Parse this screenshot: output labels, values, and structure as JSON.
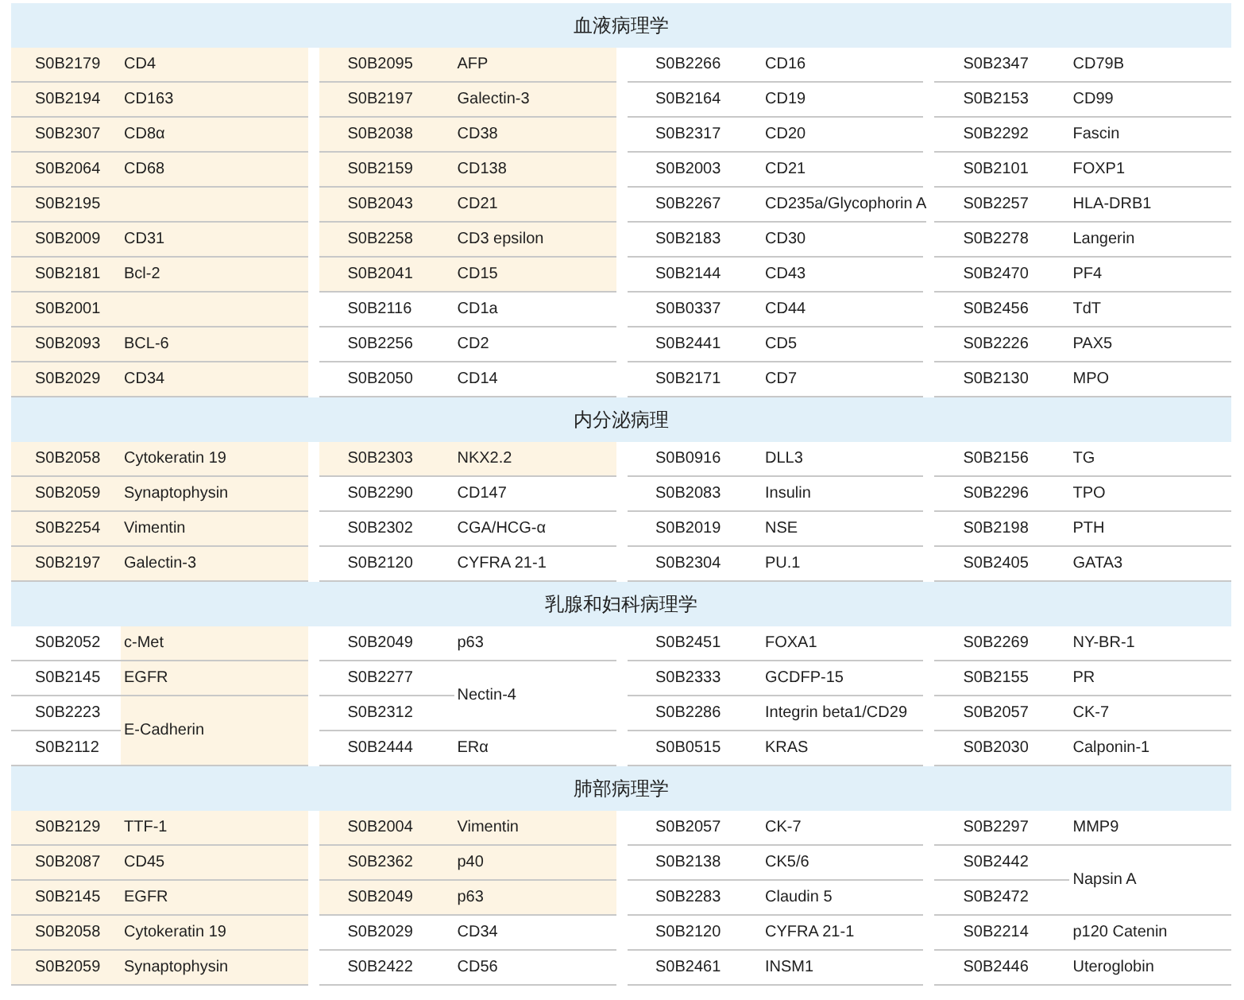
{
  "sections": [
    {
      "title": "血液病理学",
      "columns": [
        [
          {
            "codes": [
              "S0B2179"
            ],
            "name": "CD4",
            "code_shaded": true,
            "name_shaded": true
          },
          {
            "codes": [
              "S0B2194"
            ],
            "name": "CD163",
            "code_shaded": true,
            "name_shaded": true
          },
          {
            "codes": [
              "S0B2307"
            ],
            "name": "CD8α",
            "code_shaded": true,
            "name_shaded": true
          },
          {
            "codes": [
              "S0B2064"
            ],
            "name": "CD68",
            "code_shaded": true,
            "name_shaded": true
          },
          {
            "codes": [
              "S0B2195"
            ],
            "code_shaded": true,
            "name_shaded": true
          },
          {
            "codes": [
              "S0B2009"
            ],
            "name": "CD31",
            "code_shaded": true,
            "name_shaded": true
          },
          {
            "codes": [
              "S0B2181"
            ],
            "name": "Bcl-2",
            "code_shaded": true,
            "name_shaded": true
          },
          {
            "codes": [
              "S0B2001"
            ],
            "code_shaded": true,
            "name_shaded": true
          },
          {
            "codes": [
              "S0B2093"
            ],
            "name": "BCL-6",
            "code_shaded": true,
            "name_shaded": true
          },
          {
            "codes": [
              "S0B2029"
            ],
            "name": "CD34",
            "code_shaded": true,
            "name_shaded": true
          }
        ],
        [
          {
            "codes": [
              "S0B2095"
            ],
            "name": "AFP",
            "code_shaded": true,
            "name_shaded": true
          },
          {
            "codes": [
              "S0B2197"
            ],
            "name": "Galectin-3",
            "code_shaded": true,
            "name_shaded": true
          },
          {
            "codes": [
              "S0B2038"
            ],
            "name": "CD38",
            "code_shaded": true,
            "name_shaded": true
          },
          {
            "codes": [
              "S0B2159"
            ],
            "name": "CD138",
            "code_shaded": true,
            "name_shaded": true
          },
          {
            "codes": [
              "S0B2043"
            ],
            "name": "CD21",
            "code_shaded": true,
            "name_shaded": true
          },
          {
            "codes": [
              "S0B2258"
            ],
            "name": "CD3 epsilon",
            "code_shaded": true,
            "name_shaded": true
          },
          {
            "codes": [
              "S0B2041"
            ],
            "name": "CD15",
            "code_shaded": true,
            "name_shaded": true
          },
          {
            "codes": [
              "S0B2116"
            ],
            "name": "CD1a",
            "code_shaded": false,
            "name_shaded": false
          },
          {
            "codes": [
              "S0B2256"
            ],
            "name": "CD2",
            "code_shaded": false,
            "name_shaded": false
          },
          {
            "codes": [
              "S0B2050"
            ],
            "name": "CD14",
            "code_shaded": false,
            "name_shaded": false
          }
        ],
        [
          {
            "codes": [
              "S0B2266"
            ],
            "name": "CD16",
            "code_shaded": false,
            "name_shaded": false
          },
          {
            "codes": [
              "S0B2164"
            ],
            "name": "CD19",
            "code_shaded": false,
            "name_shaded": false
          },
          {
            "codes": [
              "S0B2317"
            ],
            "name": "CD20",
            "code_shaded": false,
            "name_shaded": false
          },
          {
            "codes": [
              "S0B2003"
            ],
            "name": "CD21",
            "code_shaded": false,
            "name_shaded": false
          },
          {
            "codes": [
              "S0B2267"
            ],
            "name": "CD235a/Glycophorin A",
            "code_shaded": false,
            "name_shaded": false
          },
          {
            "codes": [
              "S0B2183"
            ],
            "name": "CD30",
            "code_shaded": false,
            "name_shaded": false
          },
          {
            "codes": [
              "S0B2144"
            ],
            "name": "CD43",
            "code_shaded": false,
            "name_shaded": false
          },
          {
            "codes": [
              "S0B0337"
            ],
            "name": "CD44",
            "code_shaded": false,
            "name_shaded": false
          },
          {
            "codes": [
              "S0B2441"
            ],
            "name": "CD5",
            "code_shaded": false,
            "name_shaded": false
          },
          {
            "codes": [
              "S0B2171"
            ],
            "name": "CD7",
            "code_shaded": false,
            "name_shaded": false
          }
        ],
        [
          {
            "codes": [
              "S0B2347"
            ],
            "name": "CD79B",
            "code_shaded": false,
            "name_shaded": false
          },
          {
            "codes": [
              "S0B2153"
            ],
            "name": "CD99",
            "code_shaded": false,
            "name_shaded": false
          },
          {
            "codes": [
              "S0B2292"
            ],
            "name": "Fascin",
            "code_shaded": false,
            "name_shaded": false
          },
          {
            "codes": [
              "S0B2101"
            ],
            "name": "FOXP1",
            "code_shaded": false,
            "name_shaded": false
          },
          {
            "codes": [
              "S0B2257"
            ],
            "name": "HLA-DRB1",
            "code_shaded": false,
            "name_shaded": false
          },
          {
            "codes": [
              "S0B2278"
            ],
            "name": "Langerin",
            "code_shaded": false,
            "name_shaded": false
          },
          {
            "codes": [
              "S0B2470"
            ],
            "name": "PF4",
            "code_shaded": false,
            "name_shaded": false
          },
          {
            "codes": [
              "S0B2456"
            ],
            "name": "TdT",
            "code_shaded": false,
            "name_shaded": false
          },
          {
            "codes": [
              "S0B2226"
            ],
            "name": "PAX5",
            "code_shaded": false,
            "name_shaded": false
          },
          {
            "codes": [
              "S0B2130"
            ],
            "name": "MPO",
            "code_shaded": false,
            "name_shaded": false
          }
        ]
      ]
    },
    {
      "title": "内分泌病理",
      "columns": [
        [
          {
            "codes": [
              "S0B2058"
            ],
            "name": "Cytokeratin 19",
            "code_shaded": true,
            "name_shaded": true
          },
          {
            "codes": [
              "S0B2059"
            ],
            "name": "Synaptophysin",
            "code_shaded": true,
            "name_shaded": true
          },
          {
            "codes": [
              "S0B2254"
            ],
            "name": "Vimentin",
            "code_shaded": true,
            "name_shaded": true
          },
          {
            "codes": [
              "S0B2197"
            ],
            "name": "Galectin-3",
            "code_shaded": true,
            "name_shaded": true
          }
        ],
        [
          {
            "codes": [
              "S0B2303"
            ],
            "name": "NKX2.2",
            "code_shaded": true,
            "name_shaded": true
          },
          {
            "codes": [
              "S0B2290"
            ],
            "name": "CD147",
            "code_shaded": false,
            "name_shaded": false
          },
          {
            "codes": [
              "S0B2302"
            ],
            "name": "CGA/HCG-α",
            "code_shaded": false,
            "name_shaded": false
          },
          {
            "codes": [
              "S0B2120"
            ],
            "name": "CYFRA 21-1",
            "code_shaded": false,
            "name_shaded": false
          }
        ],
        [
          {
            "codes": [
              "S0B0916"
            ],
            "name": "DLL3",
            "code_shaded": false,
            "name_shaded": false
          },
          {
            "codes": [
              "S0B2083"
            ],
            "name": "Insulin",
            "code_shaded": false,
            "name_shaded": false
          },
          {
            "codes": [
              "S0B2019"
            ],
            "name": "NSE",
            "code_shaded": false,
            "name_shaded": false
          },
          {
            "codes": [
              "S0B2304"
            ],
            "name": "PU.1",
            "code_shaded": false,
            "name_shaded": false
          }
        ],
        [
          {
            "codes": [
              "S0B2156"
            ],
            "name": "TG",
            "code_shaded": false,
            "name_shaded": false
          },
          {
            "codes": [
              "S0B2296"
            ],
            "name": "TPO",
            "code_shaded": false,
            "name_shaded": false
          },
          {
            "codes": [
              "S0B2198"
            ],
            "name": "PTH",
            "code_shaded": false,
            "name_shaded": false
          },
          {
            "codes": [
              "S0B2405"
            ],
            "name": "GATA3",
            "code_shaded": false,
            "name_shaded": false
          }
        ]
      ]
    },
    {
      "title": "乳腺和妇科病理学",
      "columns": [
        [
          {
            "codes": [
              "S0B2052"
            ],
            "name": "c-Met",
            "code_shaded": false,
            "name_shaded": true
          },
          {
            "codes": [
              "S0B2145"
            ],
            "name": "EGFR",
            "code_shaded": false,
            "name_shaded": true
          },
          {
            "codes": [
              "S0B2223",
              "S0B2112"
            ],
            "name": "E-Cadherin",
            "code_shaded": false,
            "name_shaded": true
          }
        ],
        [
          {
            "codes": [
              "S0B2049"
            ],
            "name": "p63",
            "code_shaded": false,
            "name_shaded": false
          },
          {
            "codes": [
              "S0B2277",
              "S0B2312"
            ],
            "name": "Nectin-4",
            "code_shaded": false,
            "name_shaded": false
          },
          {
            "codes": [
              "S0B2444"
            ],
            "name": "ERα",
            "code_shaded": false,
            "name_shaded": false
          }
        ],
        [
          {
            "codes": [
              "S0B2451"
            ],
            "name": "FOXA1",
            "code_shaded": false,
            "name_shaded": false
          },
          {
            "codes": [
              "S0B2333"
            ],
            "name": "GCDFP-15",
            "code_shaded": false,
            "name_shaded": false
          },
          {
            "codes": [
              "S0B2286"
            ],
            "name": "Integrin beta1/CD29",
            "code_shaded": false,
            "name_shaded": false
          },
          {
            "codes": [
              "S0B0515"
            ],
            "name": "KRAS",
            "code_shaded": false,
            "name_shaded": false
          }
        ],
        [
          {
            "codes": [
              "S0B2269"
            ],
            "name": "NY-BR-1",
            "code_shaded": false,
            "name_shaded": false
          },
          {
            "codes": [
              "S0B2155"
            ],
            "name": "PR",
            "code_shaded": false,
            "name_shaded": false
          },
          {
            "codes": [
              "S0B2057"
            ],
            "name": "CK-7",
            "code_shaded": false,
            "name_shaded": false
          },
          {
            "codes": [
              "S0B2030"
            ],
            "name": "Calponin-1",
            "code_shaded": false,
            "name_shaded": false
          }
        ]
      ]
    },
    {
      "title": "肺部病理学",
      "columns": [
        [
          {
            "codes": [
              "S0B2129"
            ],
            "name": "TTF-1",
            "code_shaded": true,
            "name_shaded": true
          },
          {
            "codes": [
              "S0B2087"
            ],
            "name": "CD45",
            "code_shaded": true,
            "name_shaded": true
          },
          {
            "codes": [
              "S0B2145"
            ],
            "name": "EGFR",
            "code_shaded": true,
            "name_shaded": true
          },
          {
            "codes": [
              "S0B2058"
            ],
            "name": "Cytokeratin 19",
            "code_shaded": true,
            "name_shaded": true
          },
          {
            "codes": [
              "S0B2059"
            ],
            "name": "Synaptophysin",
            "code_shaded": true,
            "name_shaded": true
          }
        ],
        [
          {
            "codes": [
              "S0B2004"
            ],
            "name": "Vimentin",
            "code_shaded": true,
            "name_shaded": true
          },
          {
            "codes": [
              "S0B2362"
            ],
            "name": "p40",
            "code_shaded": true,
            "name_shaded": true
          },
          {
            "codes": [
              "S0B2049"
            ],
            "name": "p63",
            "code_shaded": true,
            "name_shaded": true
          },
          {
            "codes": [
              "S0B2029"
            ],
            "name": "CD34",
            "code_shaded": false,
            "name_shaded": false
          },
          {
            "codes": [
              "S0B2422"
            ],
            "name": "CD56",
            "code_shaded": false,
            "name_shaded": false
          }
        ],
        [
          {
            "codes": [
              "S0B2057"
            ],
            "name": "CK-7",
            "code_shaded": false,
            "name_shaded": false
          },
          {
            "codes": [
              "S0B2138"
            ],
            "name": "CK5/6",
            "code_shaded": false,
            "name_shaded": false
          },
          {
            "codes": [
              "S0B2283"
            ],
            "name": "Claudin 5",
            "code_shaded": false,
            "name_shaded": false
          },
          {
            "codes": [
              "S0B2120"
            ],
            "name": "CYFRA 21-1",
            "code_shaded": false,
            "name_shaded": false
          },
          {
            "codes": [
              "S0B2461"
            ],
            "name": "INSM1",
            "code_shaded": false,
            "name_shaded": false
          }
        ],
        [
          {
            "codes": [
              "S0B2297"
            ],
            "name": "MMP9",
            "code_shaded": false,
            "name_shaded": false
          },
          {
            "codes": [
              "S0B2442",
              "S0B2472"
            ],
            "name": "Napsin A",
            "code_shaded": false,
            "name_shaded": false
          },
          {
            "codes": [
              "S0B2214"
            ],
            "name": "p120 Catenin",
            "code_shaded": false,
            "name_shaded": false
          },
          {
            "codes": [
              "S0B2446"
            ],
            "name": "Uteroglobin",
            "code_shaded": false,
            "name_shaded": false
          }
        ]
      ]
    }
  ]
}
